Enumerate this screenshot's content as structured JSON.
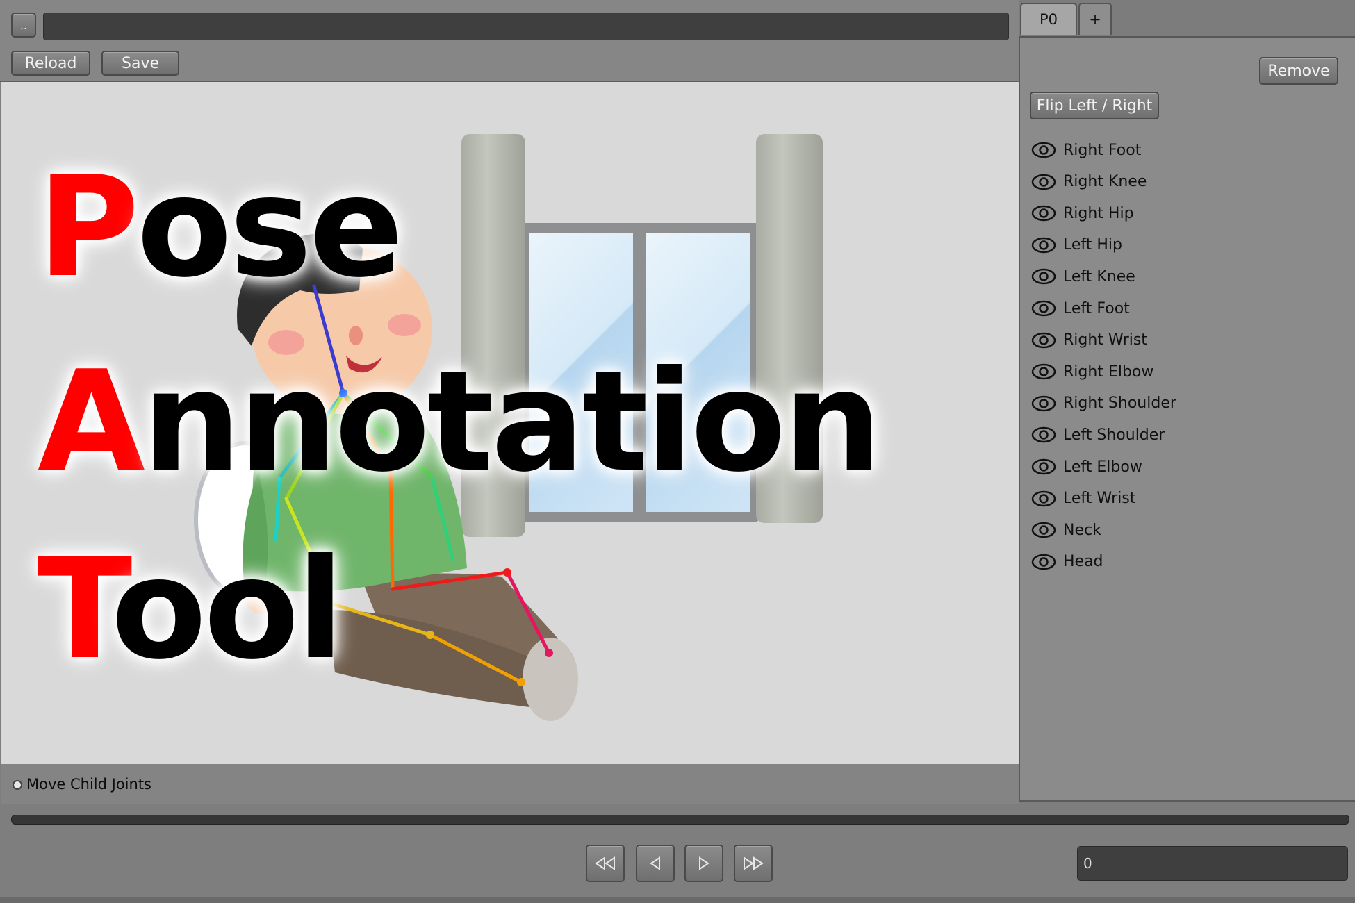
{
  "toolbar": {
    "parent_button": "..",
    "path_value": "",
    "reload_label": "Reload",
    "save_label": "Save"
  },
  "title": {
    "lines": [
      {
        "first": "P",
        "rest": "ose"
      },
      {
        "first": "A",
        "rest": "nnotation"
      },
      {
        "first": "T",
        "rest": "ool"
      }
    ],
    "accent_color": "#ff0000"
  },
  "options": {
    "move_child_joints_label": "Move Child Joints"
  },
  "playback": {
    "first_icon": "first-frame-icon",
    "prev_icon": "prev-frame-icon",
    "next_icon": "next-frame-icon",
    "last_icon": "last-frame-icon",
    "frame_value": "0"
  },
  "panel": {
    "tabs": [
      {
        "label": "P0"
      },
      {
        "label": "+"
      }
    ],
    "remove_label": "Remove",
    "flip_label": "Flip Left / Right",
    "joints": [
      {
        "label": "Right Foot"
      },
      {
        "label": "Right Knee"
      },
      {
        "label": "Right Hip"
      },
      {
        "label": "Left Hip"
      },
      {
        "label": "Left Knee"
      },
      {
        "label": "Left Foot"
      },
      {
        "label": "Right Wrist"
      },
      {
        "label": "Right Elbow"
      },
      {
        "label": "Right Shoulder"
      },
      {
        "label": "Left Shoulder"
      },
      {
        "label": "Left Elbow"
      },
      {
        "label": "Left Wrist"
      },
      {
        "label": "Neck"
      },
      {
        "label": "Head"
      }
    ]
  }
}
